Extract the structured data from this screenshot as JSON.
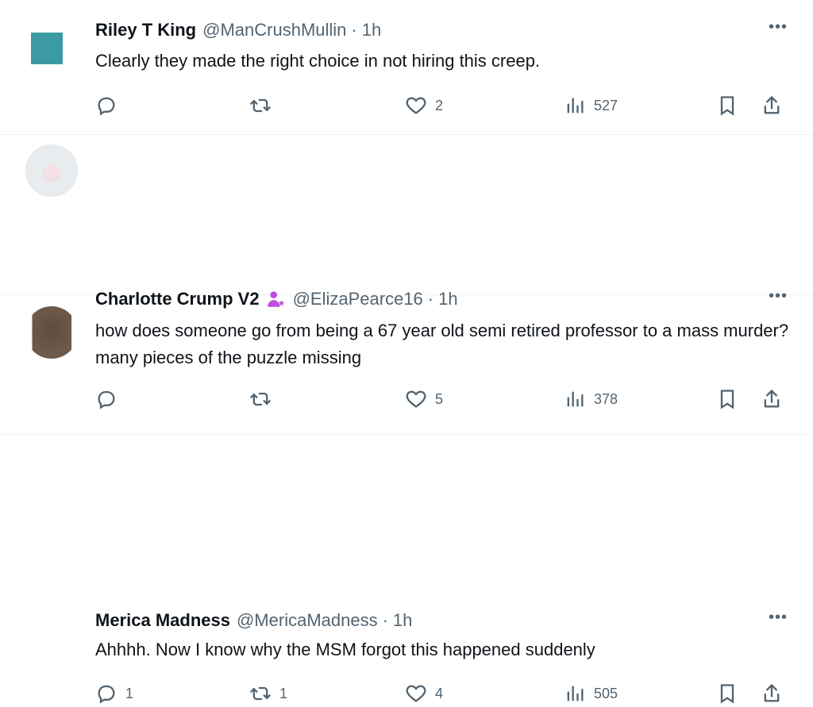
{
  "tweets": [
    {
      "author_name": "Riley T King",
      "handle": "@ManCrushMullin",
      "time": "1h",
      "text": "Clearly they made the right choice in not hiring this creep.",
      "reply_count": "",
      "retweet_count": "",
      "like_count": "2",
      "view_count": "527",
      "avatar_color": "#3b9aa3",
      "badge_icon": ""
    },
    {
      "author_name": "Charlotte Crump V2",
      "handle": "@ElizaPearce16",
      "time": "1h",
      "text": "how does someone go from being a 67 year old semi retired professor to a mass murder? many pieces of the puzzle missing",
      "reply_count": "",
      "retweet_count": "",
      "like_count": "5",
      "view_count": "378",
      "avatar_color": "#f2e0e4",
      "badge_icon": "purple-person-icon"
    },
    {
      "author_name": "Merica Madness",
      "handle": "@MericaMadness",
      "time": "1h",
      "text": "Ahhhh. Now I know why the MSM forgot this happened suddenly",
      "reply_count": "1",
      "retweet_count": "1",
      "like_count": "4",
      "view_count": "505",
      "avatar_color": "#6f5a49",
      "badge_icon": ""
    }
  ],
  "separator": "·",
  "more_label": "•••",
  "colors": {
    "text": "#0f1419",
    "secondary": "#536471",
    "divider": "#eff3f4",
    "badge": "#c04ddf"
  }
}
